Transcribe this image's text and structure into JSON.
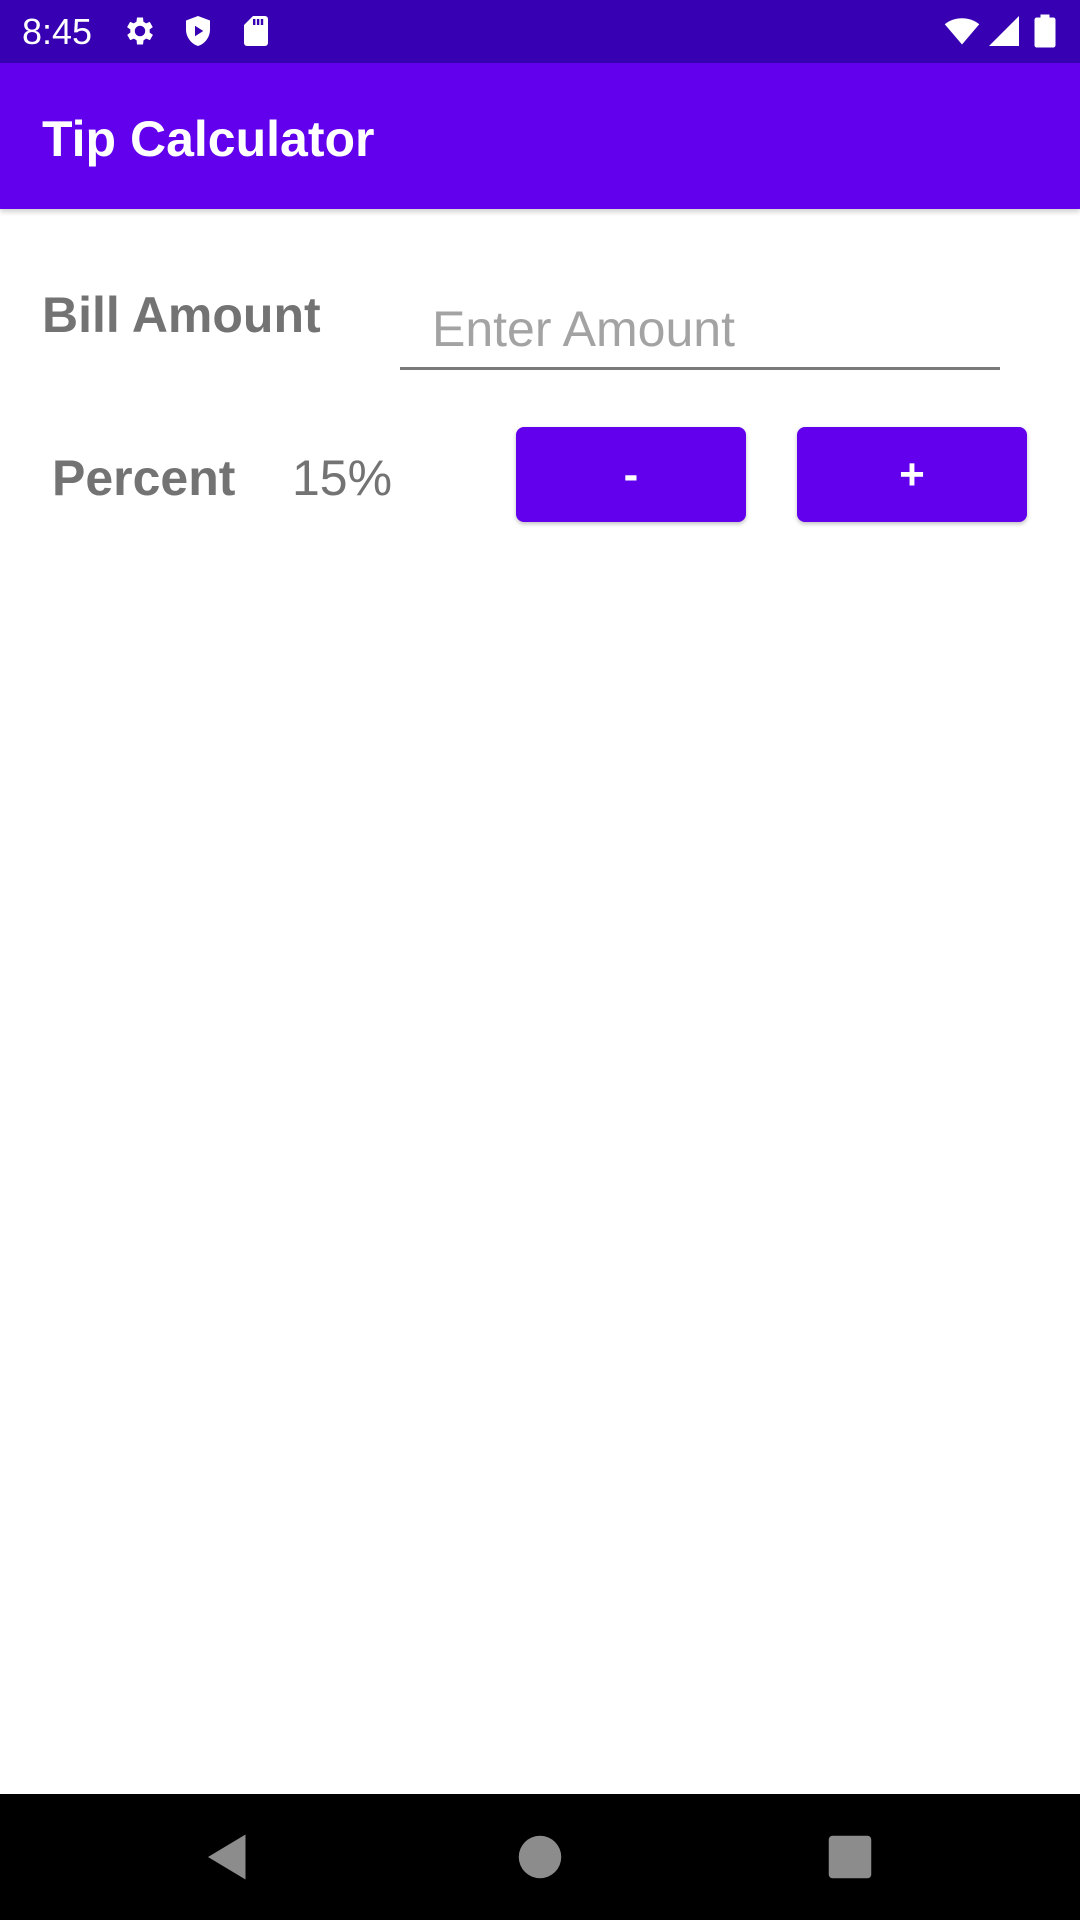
{
  "status_bar": {
    "time": "8:45",
    "left_icons": [
      "gear-icon",
      "shield-icon",
      "sd-card-icon"
    ],
    "right_icons": [
      "wifi-icon",
      "signal-icon",
      "battery-icon"
    ],
    "background_color": "#3700B3"
  },
  "app_bar": {
    "title": "Tip Calculator",
    "background_color": "#6200EE"
  },
  "bill": {
    "label": "Bill Amount",
    "input_value": "",
    "placeholder": "Enter Amount"
  },
  "percent": {
    "label": "Percent",
    "value": "15%",
    "decrease_label": "-",
    "increase_label": "+"
  },
  "nav_bar": {
    "buttons": [
      "back-icon",
      "home-icon",
      "recents-icon"
    ]
  },
  "colors": {
    "accent": "#6200EE",
    "label_text": "#737373",
    "placeholder_text": "#A3A3A3"
  }
}
